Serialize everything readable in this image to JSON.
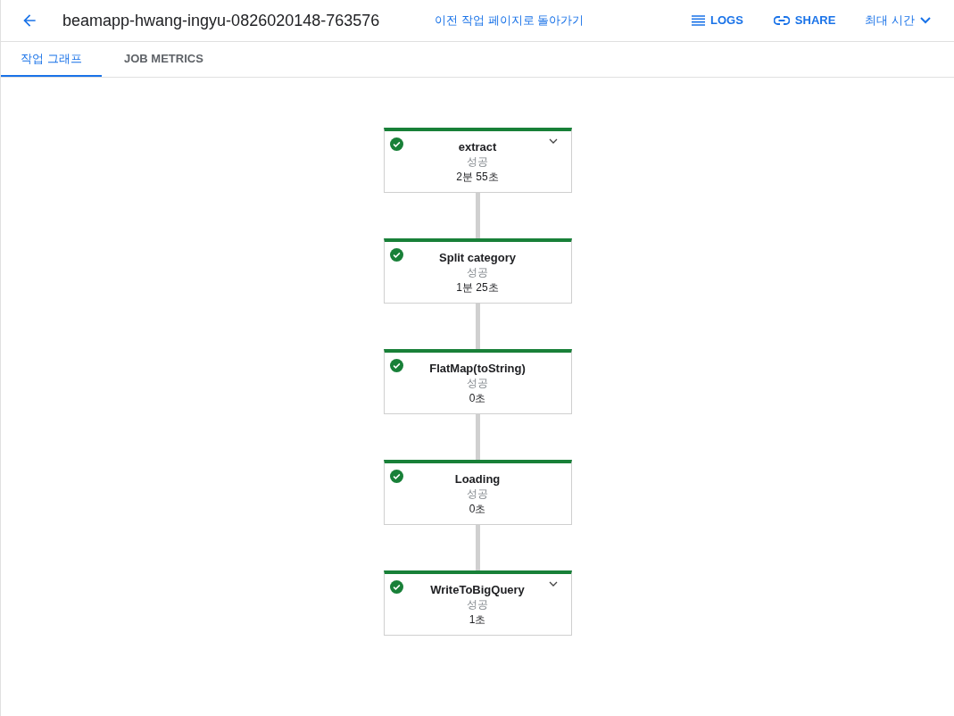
{
  "header": {
    "title": "beamapp-hwang-ingyu-0826020148-763576",
    "back_link": "이전 작업 페이지로 돌아가기",
    "logs": "LOGS",
    "share": "SHARE",
    "time_range": "최대 시간"
  },
  "tabs": [
    {
      "label": "작업 그래프",
      "selected": true
    },
    {
      "label": "JOB METRICS",
      "selected": false
    }
  ],
  "graph": {
    "nodes": [
      {
        "name": "extract",
        "kind": "success",
        "status_label": "성공",
        "duration": "2분 55초",
        "expandable": true
      },
      {
        "name": "Split category",
        "kind": "success",
        "status_label": "성공",
        "duration": "1분 25초",
        "expandable": false
      },
      {
        "name": "FlatMap(toString)",
        "kind": "success",
        "status_label": "성공",
        "duration": "0초",
        "expandable": false
      },
      {
        "name": "Loading",
        "kind": "success",
        "status_label": "성공",
        "duration": "0초",
        "expandable": false
      },
      {
        "name": "WriteToBigQuery",
        "kind": "success",
        "status_label": "성공",
        "duration": "1초",
        "expandable": true
      }
    ]
  }
}
